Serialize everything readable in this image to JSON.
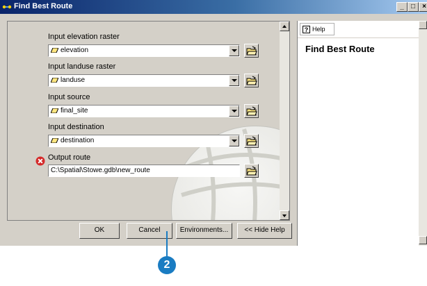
{
  "window": {
    "title": "Find Best Route",
    "controls": [
      "_",
      "□",
      "×"
    ]
  },
  "form": {
    "fields": [
      {
        "label": "Input elevation raster",
        "value": "elevation"
      },
      {
        "label": "Input landuse raster",
        "value": "landuse"
      },
      {
        "label": "Input source",
        "value": "final_site"
      },
      {
        "label": "Input destination",
        "value": "destination"
      }
    ],
    "output": {
      "label": "Output route",
      "value": "C:\\Spatial\\Stowe.gdb\\new_route"
    }
  },
  "buttons": {
    "ok": "OK",
    "cancel": "Cancel",
    "environments": "Environments...",
    "hide_help": "<< Hide Help"
  },
  "help": {
    "button_label": "Help",
    "title": "Find Best Route"
  },
  "callout": {
    "number": "2"
  },
  "colors": {
    "titlebar": "#0a246a",
    "callout": "#1a7cc2",
    "error": "#d42a2a"
  }
}
